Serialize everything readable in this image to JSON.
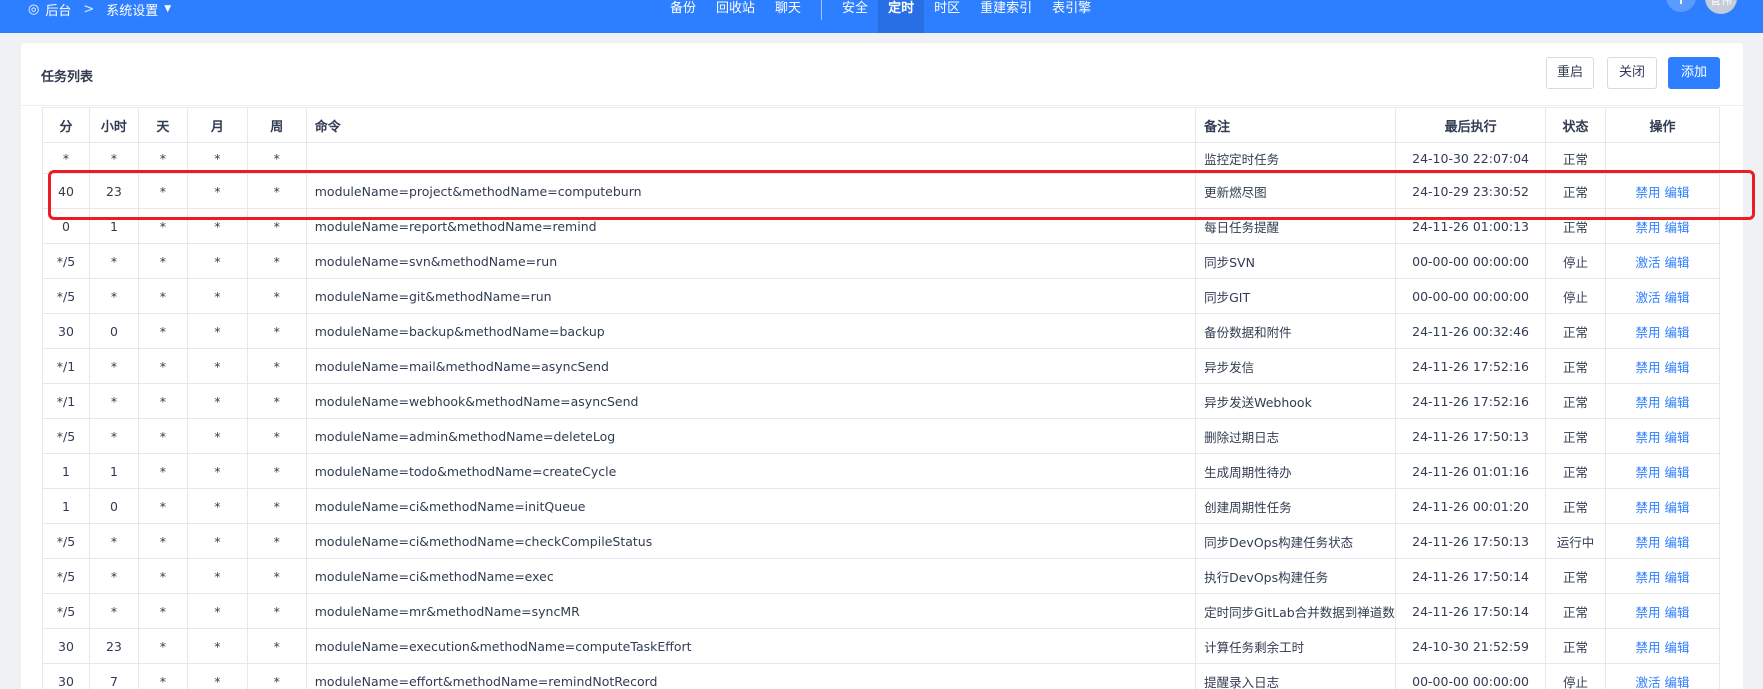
{
  "topbar": {
    "back_label": "后台",
    "section_label": "系统设置",
    "nav": [
      "备份",
      "回收站",
      "聊天",
      "安全",
      "定时",
      "时区",
      "重建索引",
      "表引擎"
    ],
    "active": "定时",
    "avatar_text": "管伟"
  },
  "panel": {
    "title": "任务列表",
    "restart_label": "重启",
    "close_label": "关闭",
    "add_label": "添加"
  },
  "table": {
    "headers": [
      "分",
      "小时",
      "天",
      "月",
      "周",
      "命令",
      "备注",
      "最后执行",
      "状态",
      "操作"
    ],
    "rows": [
      {
        "min": "*",
        "hour": "*",
        "day": "*",
        "month": "*",
        "week": "*",
        "cmd": "",
        "note": "监控定时任务",
        "last": "24-10-30 22:07:04",
        "status": "正常",
        "op1": "",
        "op2": ""
      },
      {
        "min": "40",
        "hour": "23",
        "day": "*",
        "month": "*",
        "week": "*",
        "cmd": "moduleName=project&methodName=computeburn",
        "note": "更新燃尽图",
        "last": "24-10-29 23:30:52",
        "status": "正常",
        "op1": "禁用",
        "op2": "编辑"
      },
      {
        "min": "0",
        "hour": "1",
        "day": "*",
        "month": "*",
        "week": "*",
        "cmd": "moduleName=report&methodName=remind",
        "note": "每日任务提醒",
        "last": "24-11-26 01:00:13",
        "status": "正常",
        "op1": "禁用",
        "op2": "编辑"
      },
      {
        "min": "*/5",
        "hour": "*",
        "day": "*",
        "month": "*",
        "week": "*",
        "cmd": "moduleName=svn&methodName=run",
        "note": "同步SVN",
        "last": "00-00-00 00:00:00",
        "status": "停止",
        "op1": "激活",
        "op2": "编辑"
      },
      {
        "min": "*/5",
        "hour": "*",
        "day": "*",
        "month": "*",
        "week": "*",
        "cmd": "moduleName=git&methodName=run",
        "note": "同步GIT",
        "last": "00-00-00 00:00:00",
        "status": "停止",
        "op1": "激活",
        "op2": "编辑"
      },
      {
        "min": "30",
        "hour": "0",
        "day": "*",
        "month": "*",
        "week": "*",
        "cmd": "moduleName=backup&methodName=backup",
        "note": "备份数据和附件",
        "last": "24-11-26 00:32:46",
        "status": "正常",
        "op1": "禁用",
        "op2": "编辑"
      },
      {
        "min": "*/1",
        "hour": "*",
        "day": "*",
        "month": "*",
        "week": "*",
        "cmd": "moduleName=mail&methodName=asyncSend",
        "note": "异步发信",
        "last": "24-11-26 17:52:16",
        "status": "正常",
        "op1": "禁用",
        "op2": "编辑"
      },
      {
        "min": "*/1",
        "hour": "*",
        "day": "*",
        "month": "*",
        "week": "*",
        "cmd": "moduleName=webhook&methodName=asyncSend",
        "note": "异步发送Webhook",
        "last": "24-11-26 17:52:16",
        "status": "正常",
        "op1": "禁用",
        "op2": "编辑"
      },
      {
        "min": "*/5",
        "hour": "*",
        "day": "*",
        "month": "*",
        "week": "*",
        "cmd": "moduleName=admin&methodName=deleteLog",
        "note": "删除过期日志",
        "last": "24-11-26 17:50:13",
        "status": "正常",
        "op1": "禁用",
        "op2": "编辑"
      },
      {
        "min": "1",
        "hour": "1",
        "day": "*",
        "month": "*",
        "week": "*",
        "cmd": "moduleName=todo&methodName=createCycle",
        "note": "生成周期性待办",
        "last": "24-11-26 01:01:16",
        "status": "正常",
        "op1": "禁用",
        "op2": "编辑"
      },
      {
        "min": "1",
        "hour": "0",
        "day": "*",
        "month": "*",
        "week": "*",
        "cmd": "moduleName=ci&methodName=initQueue",
        "note": "创建周期性任务",
        "last": "24-11-26 00:01:20",
        "status": "正常",
        "op1": "禁用",
        "op2": "编辑"
      },
      {
        "min": "*/5",
        "hour": "*",
        "day": "*",
        "month": "*",
        "week": "*",
        "cmd": "moduleName=ci&methodName=checkCompileStatus",
        "note": "同步DevOps构建任务状态",
        "last": "24-11-26 17:50:13",
        "status": "运行中",
        "op1": "禁用",
        "op2": "编辑"
      },
      {
        "min": "*/5",
        "hour": "*",
        "day": "*",
        "month": "*",
        "week": "*",
        "cmd": "moduleName=ci&methodName=exec",
        "note": "执行DevOps构建任务",
        "last": "24-11-26 17:50:14",
        "status": "正常",
        "op1": "禁用",
        "op2": "编辑"
      },
      {
        "min": "*/5",
        "hour": "*",
        "day": "*",
        "month": "*",
        "week": "*",
        "cmd": "moduleName=mr&methodName=syncMR",
        "note": "定时同步GitLab合并数据到禅道数",
        "last": "24-11-26 17:50:14",
        "status": "正常",
        "op1": "禁用",
        "op2": "编辑"
      },
      {
        "min": "30",
        "hour": "23",
        "day": "*",
        "month": "*",
        "week": "*",
        "cmd": "moduleName=execution&methodName=computeTaskEffort",
        "note": "计算任务剩余工时",
        "last": "24-10-30 21:52:59",
        "status": "正常",
        "op1": "禁用",
        "op2": "编辑"
      },
      {
        "min": "30",
        "hour": "7",
        "day": "*",
        "month": "*",
        "week": "*",
        "cmd": "moduleName=effort&methodName=remindNotRecord",
        "note": "提醒录入日志",
        "last": "00-00-00 00:00:00",
        "status": "停止",
        "op1": "激活",
        "op2": "编辑"
      }
    ]
  },
  "colors": {
    "primary": "#2e7fff",
    "highlight": "#ec1c24"
  }
}
